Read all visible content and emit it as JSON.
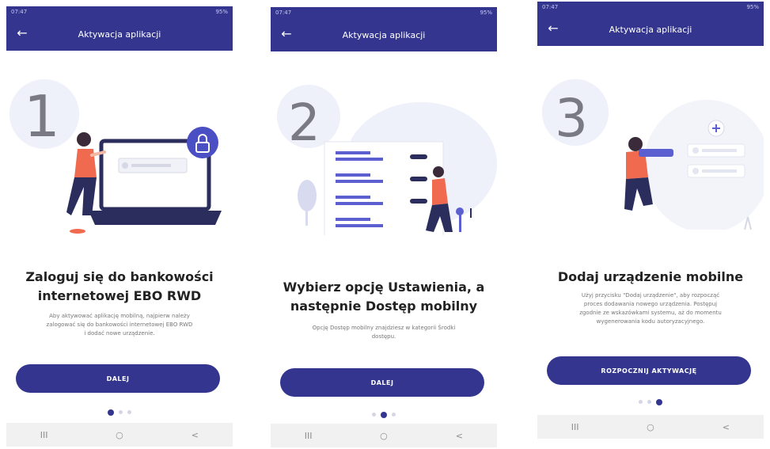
{
  "screens": [
    {
      "status_time": "07:47",
      "status_right": "95%",
      "title_bar": "Aktywacja aplikacji",
      "step": "1",
      "heading_line1": "Zaloguj się do bankowości",
      "heading_line2": "internetowej EBO RWD",
      "desc_line1": "Aby aktywować aplikację mobilną, najpierw należy",
      "desc_line2": "zalogować się do bankowości internetowej EBO RWD",
      "desc_line3": "i dodać nowe urządzenie.",
      "button_label": "DALEJ",
      "active_dot": 0
    },
    {
      "status_time": "07:47",
      "status_right": "95%",
      "title_bar": "Aktywacja aplikacji",
      "step": "2",
      "heading_line1": "Wybierz opcję Ustawienia, a",
      "heading_line2": "następnie Dostęp mobilny",
      "desc_line1": "Opcję Dostęp mobilny znajdziesz w kategorii Środki",
      "desc_line2": "dostępu.",
      "button_label": "DALEJ",
      "active_dot": 1
    },
    {
      "status_time": "07:47",
      "status_right": "95%",
      "title_bar": "Aktywacja aplikacji",
      "step": "3",
      "heading_line1": "Dodaj urządzenie mobilne",
      "desc_line1": "Użyj przycisku \"Dodaj urządzenie\", aby rozpocząć",
      "desc_line2": "proces dodawania nowego urządzenia. Postępuj",
      "desc_line3": "zgodnie ze wskazówkami systemu, aż do momentu",
      "desc_line4": "wygenerowania kodu autoryzacyjnego.",
      "button_label": "ROZPOCZNIJ AKTYWACJĘ",
      "active_dot": 2
    }
  ],
  "nav": {
    "recents": "III",
    "home": "○",
    "back": "<"
  },
  "colors": {
    "primary": "#33358f",
    "blob": "#eef0fa",
    "accent": "#f06a4f",
    "device": "#2b2e5c"
  },
  "icons": {
    "back": "arrow-left-icon",
    "lock": "lock-icon",
    "plus": "plus-icon"
  }
}
